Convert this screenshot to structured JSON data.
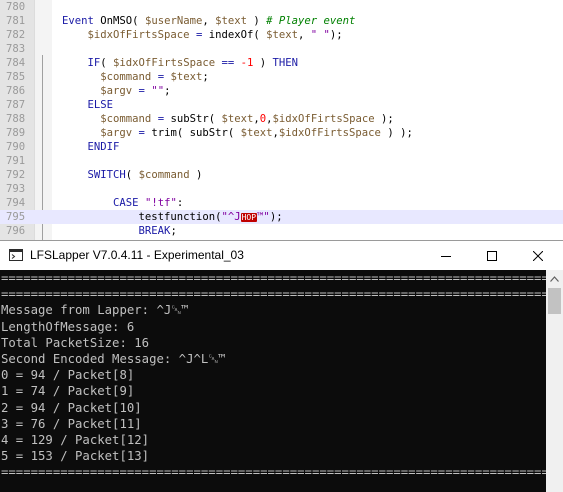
{
  "editor": {
    "lines": [
      {
        "num": "780",
        "parts": []
      },
      {
        "num": "781",
        "parts": [
          [
            "kw",
            "Event "
          ],
          [
            "fn",
            "OnMSO( "
          ],
          [
            "var",
            "$userName"
          ],
          [
            "fn",
            ", "
          ],
          [
            "var",
            "$text"
          ],
          [
            "fn",
            " ) "
          ],
          [
            "cm",
            "# Player event"
          ]
        ]
      },
      {
        "num": "782",
        "parts": [
          [
            "fn",
            "    "
          ],
          [
            "var",
            "$idxOfFirtsSpace"
          ],
          [
            "op",
            " = "
          ],
          [
            "fn",
            "indexOf( "
          ],
          [
            "var",
            "$text"
          ],
          [
            "fn",
            ", "
          ],
          [
            "str",
            "\" \""
          ],
          [
            "fn",
            ");"
          ]
        ]
      },
      {
        "num": "783",
        "parts": []
      },
      {
        "num": "784",
        "parts": [
          [
            "fn",
            "    "
          ],
          [
            "kw",
            "IF"
          ],
          [
            "fn",
            "( "
          ],
          [
            "var",
            "$idxOfFirtsSpace"
          ],
          [
            "op",
            " == "
          ],
          [
            "num",
            "-1"
          ],
          [
            "fn",
            " ) "
          ],
          [
            "kw",
            "THEN"
          ]
        ]
      },
      {
        "num": "785",
        "parts": [
          [
            "fn",
            "      "
          ],
          [
            "var",
            "$command"
          ],
          [
            "op",
            " = "
          ],
          [
            "var",
            "$text"
          ],
          [
            "fn",
            ";"
          ]
        ]
      },
      {
        "num": "786",
        "parts": [
          [
            "fn",
            "      "
          ],
          [
            "var",
            "$argv"
          ],
          [
            "op",
            " = "
          ],
          [
            "str",
            "\"\""
          ],
          [
            "fn",
            ";"
          ]
        ]
      },
      {
        "num": "787",
        "parts": [
          [
            "fn",
            "    "
          ],
          [
            "kw",
            "ELSE"
          ]
        ]
      },
      {
        "num": "788",
        "parts": [
          [
            "fn",
            "      "
          ],
          [
            "var",
            "$command"
          ],
          [
            "op",
            " = "
          ],
          [
            "fn",
            "subStr( "
          ],
          [
            "var",
            "$text"
          ],
          [
            "fn",
            ","
          ],
          [
            "num",
            "0"
          ],
          [
            "fn",
            ","
          ],
          [
            "var",
            "$idxOfFirtsSpace"
          ],
          [
            "fn",
            " );"
          ]
        ]
      },
      {
        "num": "789",
        "parts": [
          [
            "fn",
            "      "
          ],
          [
            "var",
            "$argv"
          ],
          [
            "op",
            " = "
          ],
          [
            "fn",
            "trim( subStr( "
          ],
          [
            "var",
            "$text"
          ],
          [
            "fn",
            ","
          ],
          [
            "var",
            "$idxOfFirtsSpace"
          ],
          [
            "fn",
            " ) );"
          ]
        ]
      },
      {
        "num": "790",
        "parts": [
          [
            "fn",
            "    "
          ],
          [
            "kw",
            "ENDIF"
          ]
        ]
      },
      {
        "num": "791",
        "parts": []
      },
      {
        "num": "792",
        "parts": [
          [
            "fn",
            "    "
          ],
          [
            "kw",
            "SWITCH"
          ],
          [
            "fn",
            "( "
          ],
          [
            "var",
            "$command"
          ],
          [
            "fn",
            " )"
          ]
        ]
      },
      {
        "num": "793",
        "parts": []
      },
      {
        "num": "794",
        "parts": [
          [
            "fn",
            "        "
          ],
          [
            "kw",
            "CASE"
          ],
          [
            "fn",
            " "
          ],
          [
            "str",
            "\"!tf\""
          ],
          [
            "fn",
            ":"
          ]
        ]
      },
      {
        "num": "795",
        "parts": [
          [
            "fn",
            "            testfunction("
          ],
          [
            "str",
            "\"^J"
          ],
          [
            "ctrl",
            "HOP"
          ],
          [
            "str",
            "™\""
          ],
          [
            "fn",
            ");"
          ]
        ],
        "current": true
      },
      {
        "num": "796",
        "parts": [
          [
            "fn",
            "            "
          ],
          [
            "kw",
            "BREAK"
          ],
          [
            "fn",
            ";"
          ]
        ]
      }
    ]
  },
  "console": {
    "title": "LFSLapper V7.0.4.11 - Experimental_03",
    "lines": [
      "============================================================================",
      "============================================================================",
      "Message from Lapper: ^J␘™",
      "LengthOfMessage: 6",
      "Total PacketSize: 16",
      "Second Encoded Message: ^J^L␘™",
      "0 = 94 / Packet[8]",
      "1 = 74 / Packet[9]",
      "2 = 94 / Packet[10]",
      "3 = 76 / Packet[11]",
      "4 = 129 / Packet[12]",
      "5 = 153 / Packet[13]",
      "============================================================================"
    ]
  },
  "colors": {
    "keyword": "#1a1aa6",
    "variable": "#7a5c32",
    "string": "#8000a0",
    "comment": "#008000",
    "number": "#ff0000",
    "console_bg": "#0c0c0c",
    "console_text": "#c0c0c0"
  },
  "icons": {
    "app": "console-app-icon",
    "minimize": "minimize-icon",
    "maximize": "maximize-icon",
    "close": "close-icon",
    "scroll_up": "scroll-up-arrow-icon"
  }
}
